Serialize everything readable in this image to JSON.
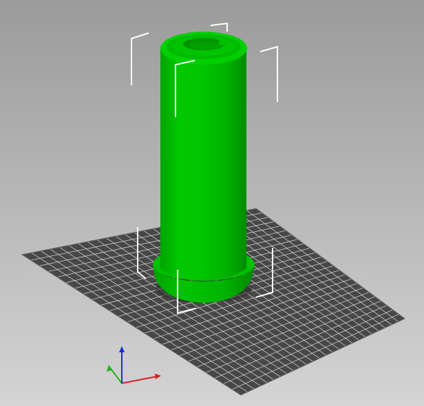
{
  "viewport": {
    "background_top": "#9a9a9a",
    "background_bottom": "#d6d6d6"
  },
  "bed": {
    "fill": "#474747",
    "grid_line": "#cfcfcf",
    "grid_divisions": 25
  },
  "model": {
    "color": "#00b000",
    "shape": "cylinder-tube-with-flange"
  },
  "selection": {
    "color": "#ffffff"
  },
  "axes_gizmo": {
    "x_color": "#d42020",
    "y_color": "#22b022",
    "z_color": "#1a2ad4"
  }
}
